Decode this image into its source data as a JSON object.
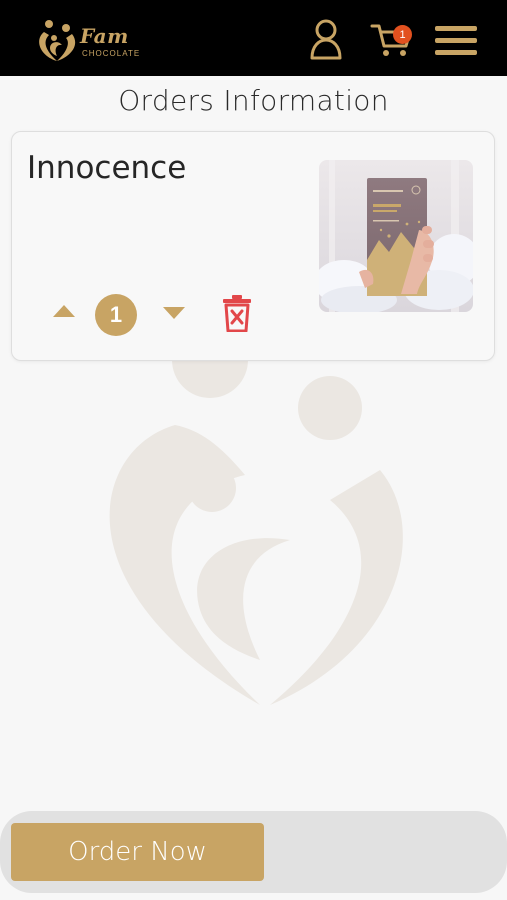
{
  "header": {
    "brand_name": "Fam",
    "brand_sub": "CHOCOLATE",
    "cart_count": "1"
  },
  "page": {
    "title": "Orders Information"
  },
  "order": {
    "product_name": "Innocence",
    "quantity": "1",
    "image_alt": "Innocence chocolate bar held in hand"
  },
  "footer": {
    "order_button": "Order Now"
  },
  "colors": {
    "header_bg": "#000000",
    "gold": "#c8a464",
    "badge": "#e2511f",
    "delete": "#e2474a",
    "background": "#f7f7f7"
  },
  "icons": [
    "fam-logo-icon",
    "user-icon",
    "cart-icon",
    "menu-icon",
    "caret-up-icon",
    "caret-down-icon",
    "trash-icon"
  ]
}
